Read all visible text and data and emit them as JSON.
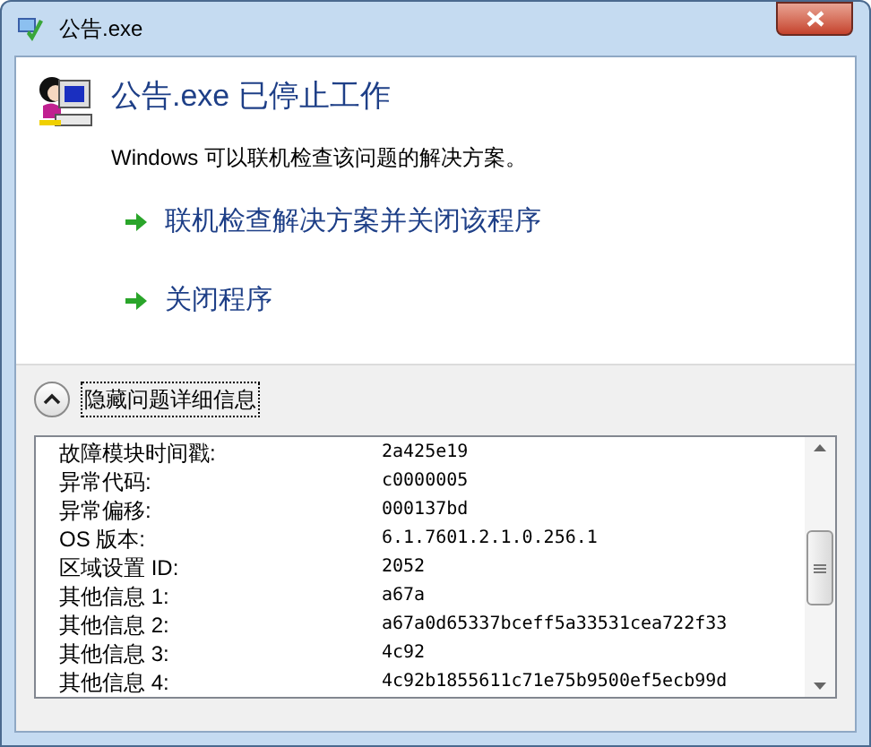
{
  "window": {
    "title": "公告.exe"
  },
  "heading": "公告.exe 已停止工作",
  "message": "Windows 可以联机检查该问题的解决方案。",
  "actions": [
    "联机检查解决方案并关闭该程序",
    "关闭程序"
  ],
  "details_toggle": {
    "label": "隐藏问题详细信息",
    "expanded": true
  },
  "details": [
    {
      "label": "故障模块时间戳:",
      "value": "2a425e19"
    },
    {
      "label": "异常代码:",
      "value": "c0000005"
    },
    {
      "label": "异常偏移:",
      "value": "000137bd"
    },
    {
      "label": "OS 版本:",
      "value": "6.1.7601.2.1.0.256.1"
    },
    {
      "label": "区域设置 ID:",
      "value": "2052"
    },
    {
      "label": "其他信息 1:",
      "value": "a67a"
    },
    {
      "label": "其他信息 2:",
      "value": "a67a0d65337bceff5a33531cea722f33"
    },
    {
      "label": "其他信息 3:",
      "value": "4c92"
    },
    {
      "label": "其他信息 4:",
      "value": "4c92b1855611c71e75b9500ef5ecb99d"
    }
  ]
}
